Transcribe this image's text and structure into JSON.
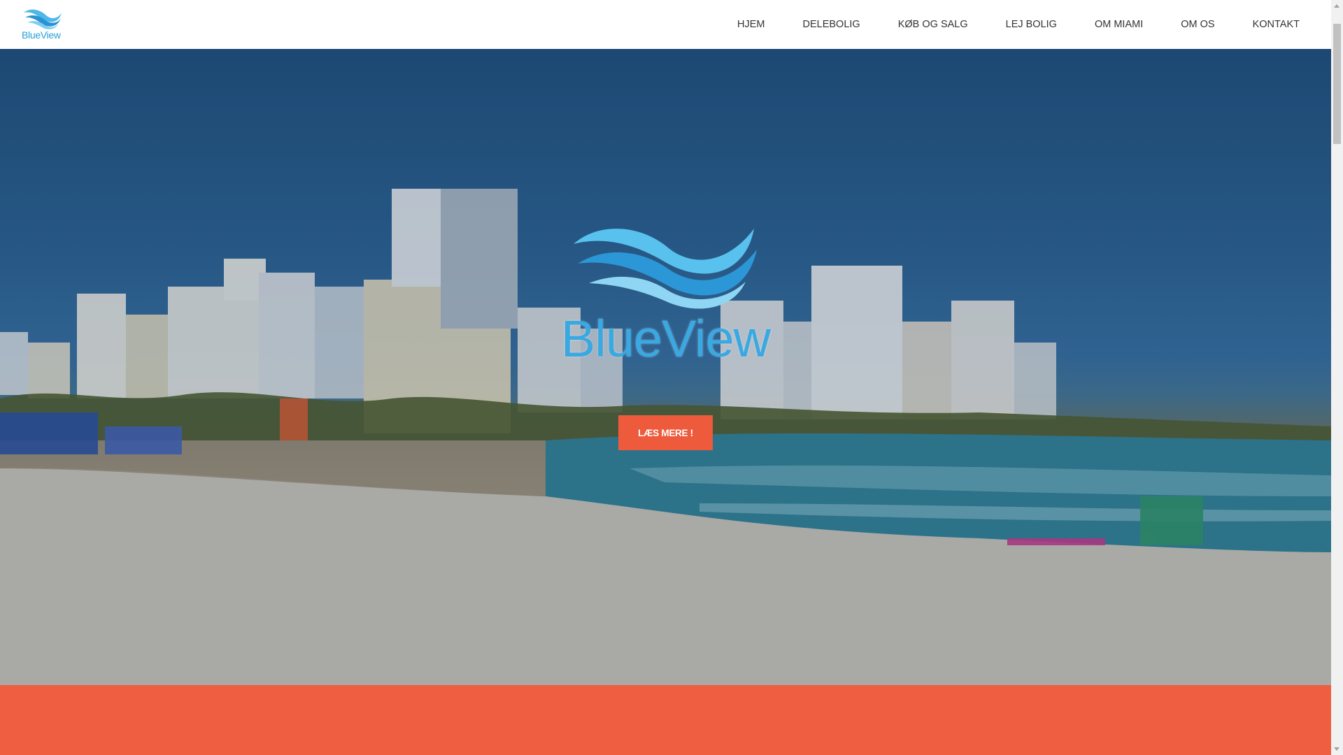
{
  "header": {
    "logo_text": "BlueView"
  },
  "nav": {
    "items": [
      {
        "label": "HJEM"
      },
      {
        "label": "DELEBOLIG"
      },
      {
        "label": "KØB OG SALG"
      },
      {
        "label": "LEJ BOLIG"
      },
      {
        "label": "OM MIAMI"
      },
      {
        "label": "OM OS"
      },
      {
        "label": "KONTAKT"
      }
    ]
  },
  "hero": {
    "brand_text": "BlueView",
    "cta_label": "LÆS MERE !"
  },
  "colors": {
    "brand_blue": "#3aa9e2",
    "accent_orange": "#ef5e40"
  },
  "icons": {
    "logo": "wave-logo-icon",
    "hero_logo": "wave-logo-icon"
  }
}
